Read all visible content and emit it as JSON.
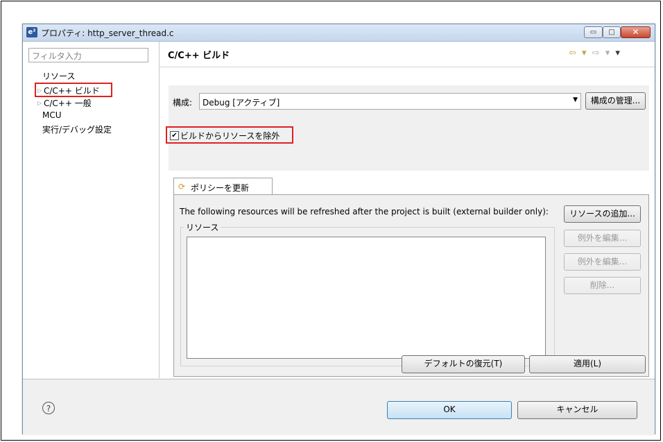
{
  "window": {
    "title": "プロパティ: http_server_thread.c",
    "app_icon": "e²",
    "minimize_glyph": "▭",
    "maximize_glyph": "□",
    "close_glyph": "✕"
  },
  "sidebar": {
    "filter_placeholder": "フィルタ入力",
    "items": [
      {
        "label": "リソース"
      },
      {
        "label": "C/C++ ビルド",
        "twisty": "▷"
      },
      {
        "label": "C/C++ 一般",
        "twisty": "▷"
      },
      {
        "label": "MCU"
      },
      {
        "label": "実行/デバッグ設定"
      }
    ]
  },
  "page": {
    "title": "C/C++ ビルド",
    "nav": {
      "back": "⇦ ▾",
      "forward": "⇨ ▾",
      "menu": "▾"
    }
  },
  "config": {
    "label": "構成:",
    "value": "Debug [アクティブ]",
    "manage_button": "構成の管理...",
    "exclude_checkbox_label": "ビルドからリソースを除外",
    "exclude_checked": true
  },
  "tabs": [
    {
      "label": "ポリシーを更新",
      "icon": "refresh-policy-icon"
    }
  ],
  "refresh_panel": {
    "description": "The following resources will be refreshed after the project is built (external builder only):",
    "group_label": "リソース",
    "add_button": "リソースの追加...",
    "edit_button_1": "例外を編集...",
    "edit_button_2": "例外を編集...",
    "delete_button": "削除..."
  },
  "page_buttons": {
    "restore_defaults": "デフォルトの復元(T)",
    "apply": "適用(L)"
  },
  "dialog_buttons": {
    "ok": "OK",
    "cancel": "キャンセル",
    "help": "?"
  },
  "colors": {
    "highlight": "#e02020"
  }
}
